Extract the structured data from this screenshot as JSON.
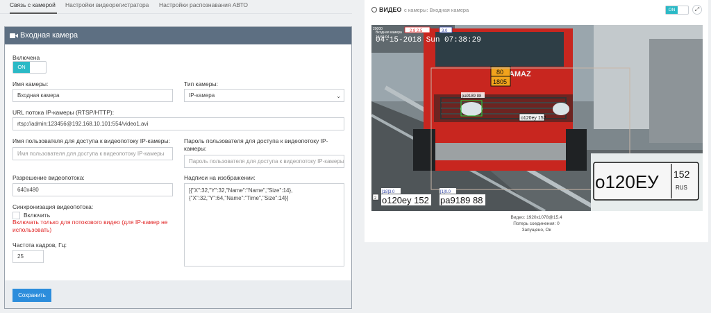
{
  "tabs": [
    {
      "label": "Связь с камерой",
      "active": true
    },
    {
      "label": "Настройки видеорегистратора",
      "active": false
    },
    {
      "label": "Настройки распознавания АВТО",
      "active": false
    }
  ],
  "panel": {
    "title": "Входная камера",
    "enabled_label": "Включена",
    "enabled_value": "ON",
    "name_label": "Имя камеры:",
    "name_value": "Входная камера",
    "type_label": "Тип камеры:",
    "type_value": "IP-камера",
    "url_label": "URL потока IP-камеры (RTSP/HTTP):",
    "url_value": "rtsp://admin:123456@192.168.10.101:554/video1.avi",
    "user_label": "Имя пользователя для доступа к видеопотоку IP-камеры:",
    "user_placeholder": "Имя пользователя для доступа к видеопотоку IP-камеры",
    "pass_label": "Пароль пользователя для доступа к видеопотоку IP-камеры:",
    "pass_placeholder": "Пароль пользователя для доступа к видеопотоку IP-камеры",
    "resolution_label": "Разрешение видеопотока:",
    "resolution_value": "640x480",
    "overlay_label": "Надписи на изображении:",
    "overlay_value": "[{\"X\":32,\"Y\":32,\"Name\":\"Name\",\"Size\":14},\n{\"X\":32,\"Y\":64,\"Name\":\"Time\",\"Size\":14}]",
    "sync_label": "Синхронизация видеопотока:",
    "sync_checkbox_label": "Включить",
    "sync_warning": "Включать только для потокового видео (для IP-камер не использовать)",
    "fps_label": "Частота кадров, Гц:",
    "fps_value": "25",
    "save_label": "Сохранить"
  },
  "video_panel": {
    "title": "ВИДЕО",
    "subtitle": "с камеры: Входная камера",
    "toggle_value": "ON",
    "expand_icon": "expand-icon",
    "overlay": {
      "corner_code": "20000",
      "cam_name": "Входная камера",
      "time_small": "15:56:04",
      "timestamp": "04-15-2018 Sun 07:38:29",
      "box_red_1": "2.8 2.5",
      "box_blue_1": "3.0",
      "truck_brand": "KAMAZ",
      "hazard_top": "80",
      "hazard_bottom": "1805",
      "plate_box_label": "ра9189 88",
      "truck_plate": "о120еу 152",
      "plate_region": "RUS",
      "result_1_tag": "[18]3.0",
      "result_1_num": "2",
      "result_1_text": "о120еу 152",
      "result_2_tag": "[1]0.0",
      "result_2_text": "ра9189 88",
      "zoom_plate_number": "о120ЕУ",
      "zoom_plate_region": "152",
      "zoom_plate_country": "RUS"
    },
    "status_video": "Видео: 1920x1078@15.4",
    "status_loss": "Потерь соединения: 0",
    "status_state": "Запущено, Ок"
  },
  "colors": {
    "panel_header": "#5d6f82",
    "toggle_on": "#2bb9c6",
    "save_button": "#2c8ddc",
    "warning": "#e02424",
    "truck": "#c8261f"
  }
}
